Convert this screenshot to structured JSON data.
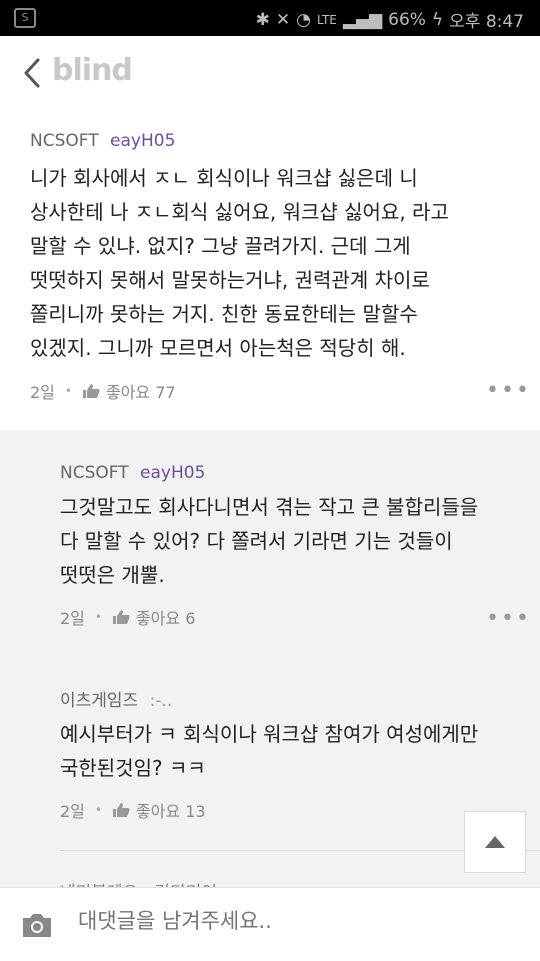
{
  "status_bar": {
    "battery": "66%",
    "time": "오후 8:47",
    "network": "LTE"
  },
  "app": {
    "logo": "blind"
  },
  "comments": [
    {
      "company": "NCSOFT",
      "user": "eayH05",
      "text_lines": [
        "니가 회사에서 ㅈㄴ 회식이나 워크샵 싫은데 니",
        "상사한테 나 ㅈㄴ회식 싫어요, 워크샵 싫어요, 라고",
        "말할 수 있냐. 없지? 그냥 끌려가지. 근데 그게",
        "떳떳하지 못해서 말못하는거냐, 권력관계 차이로",
        "쫄리니까 못하는 거지. 친한 동료한테는 말할수",
        "있겠지. 그니까 모르면서 아는척은 적당히 해."
      ],
      "age": "2일",
      "like_label": "좋아요 77"
    },
    {
      "company": "NCSOFT",
      "user": "eayH05",
      "text_lines": [
        "그것말고도 회사다니면서 겪는 작고 큰 불합리들을",
        "다 말할 수 있어?  다 쫄려서 기라면 기는 것들이",
        "떳떳은 개뿔."
      ],
      "age": "2일",
      "like_label": "좋아요 6"
    },
    {
      "company": "이츠게임즈",
      "user": ":-..",
      "text_lines": [
        "예시부터가 ㅋ 회식이나 워크샵 참여가 여성에게만",
        "국한된것임? ㅋㅋ"
      ],
      "age": "2일",
      "like_label": "좋아요 13"
    }
  ],
  "partial_next": "네미블레오 · 리디미이",
  "input": {
    "placeholder": "대댓글을 남겨주세요.."
  },
  "icons": {
    "back": "back-arrow-icon",
    "thumb": "thumbs-up-icon",
    "more": "more-dots-icon",
    "scroll_top": "arrow-up-icon",
    "camera": "camera-icon"
  }
}
